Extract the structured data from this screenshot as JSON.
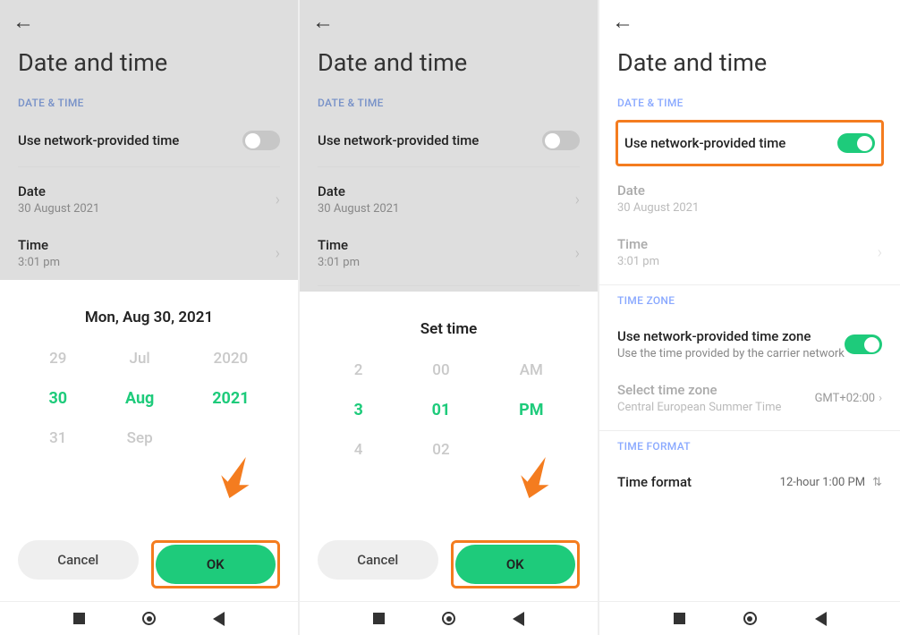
{
  "common": {
    "page_title": "Date and time",
    "section_datetime": "DATE & TIME",
    "use_network_time": "Use network-provided time",
    "date_label": "Date",
    "date_value": "30 August 2021",
    "time_label": "Time",
    "time_value": "3:01 pm",
    "cancel": "Cancel",
    "ok": "OK"
  },
  "screen1": {
    "sheet_title": "Mon, Aug 30, 2021",
    "picker": {
      "day": {
        "prev": "29",
        "sel": "30",
        "next": "31"
      },
      "month": {
        "prev": "Jul",
        "sel": "Aug",
        "next": "Sep"
      },
      "year": {
        "prev": "2020",
        "sel": "2021",
        "next": ""
      }
    }
  },
  "screen2": {
    "sheet_title": "Set time",
    "picker": {
      "hour": {
        "prev": "2",
        "sel": "3",
        "next": "4"
      },
      "minute": {
        "prev": "00",
        "sel": "01",
        "next": "02"
      },
      "ampm": {
        "prev": "AM",
        "sel": "PM",
        "next": ""
      }
    }
  },
  "screen3": {
    "section_timezone": "TIME ZONE",
    "use_network_tz": "Use network-provided time zone",
    "use_network_tz_sub": "Use the time provided by the carrier network",
    "select_tz": "Select time zone",
    "select_tz_sub": "Central European Summer Time",
    "tz_value": "GMT+02:00",
    "section_timeformat": "TIME FORMAT",
    "time_format_label": "Time format",
    "time_format_value": "12-hour 1:00 PM"
  }
}
